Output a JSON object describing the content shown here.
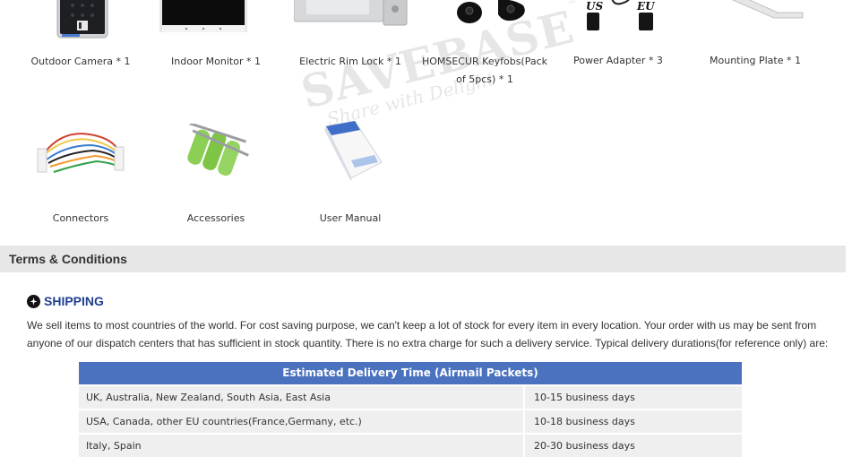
{
  "products": [
    {
      "name": "outdoor-camera",
      "label": "Outdoor Camera * 1"
    },
    {
      "name": "indoor-monitor",
      "label": "Indoor Monitor * 1"
    },
    {
      "name": "electric-rim-lock",
      "label": "Electric Rim Lock * 1"
    },
    {
      "name": "keyfobs",
      "label": "HOMSECUR Keyfobs(Pack of 5pcs) * 1"
    },
    {
      "name": "power-adapter",
      "label": "Power Adapter * 3"
    },
    {
      "name": "mounting-plate",
      "label": "Mounting Plate * 1"
    },
    {
      "name": "connectors",
      "label": "Connectors"
    },
    {
      "name": "accessories",
      "label": "Accessories"
    },
    {
      "name": "user-manual",
      "label": "User Manual"
    }
  ],
  "adapter_plug_labels": {
    "us": "US",
    "eu": "EU"
  },
  "watermark": {
    "brand": "SAVEBASE",
    "tm": "™",
    "tagline": "Share with Delight"
  },
  "terms": {
    "title": "Terms & Conditions"
  },
  "shipping": {
    "heading": "SHIPPING",
    "icon": "airplane-icon",
    "text": "We sell items to most countries of the world. For cost saving purpose, we can't keep a lot of stock for every item in every location. Your order with us may be sent from anyone of our dispatch centers that has sufficient in stock quantity. There is no extra charge for such a delivery service. Typical delivery durations(for reference only) are:"
  },
  "delivery_table": {
    "title": "Estimated Delivery Time (Airmail Packets)",
    "rows": [
      {
        "region": "UK, Australia, New Zealand, South Asia, East Asia",
        "time": "10-15 business days"
      },
      {
        "region": "USA, Canada, other EU countries(France,Germany, etc.)",
        "time": "10-18 business days"
      },
      {
        "region": "Italy, Spain",
        "time": "20-30 business days"
      }
    ]
  },
  "colors": {
    "header_blue": "#4a72bf",
    "heading_blue": "#1f3f8f",
    "bar_gray": "#e7e7e7",
    "cell_gray": "#efefef"
  }
}
